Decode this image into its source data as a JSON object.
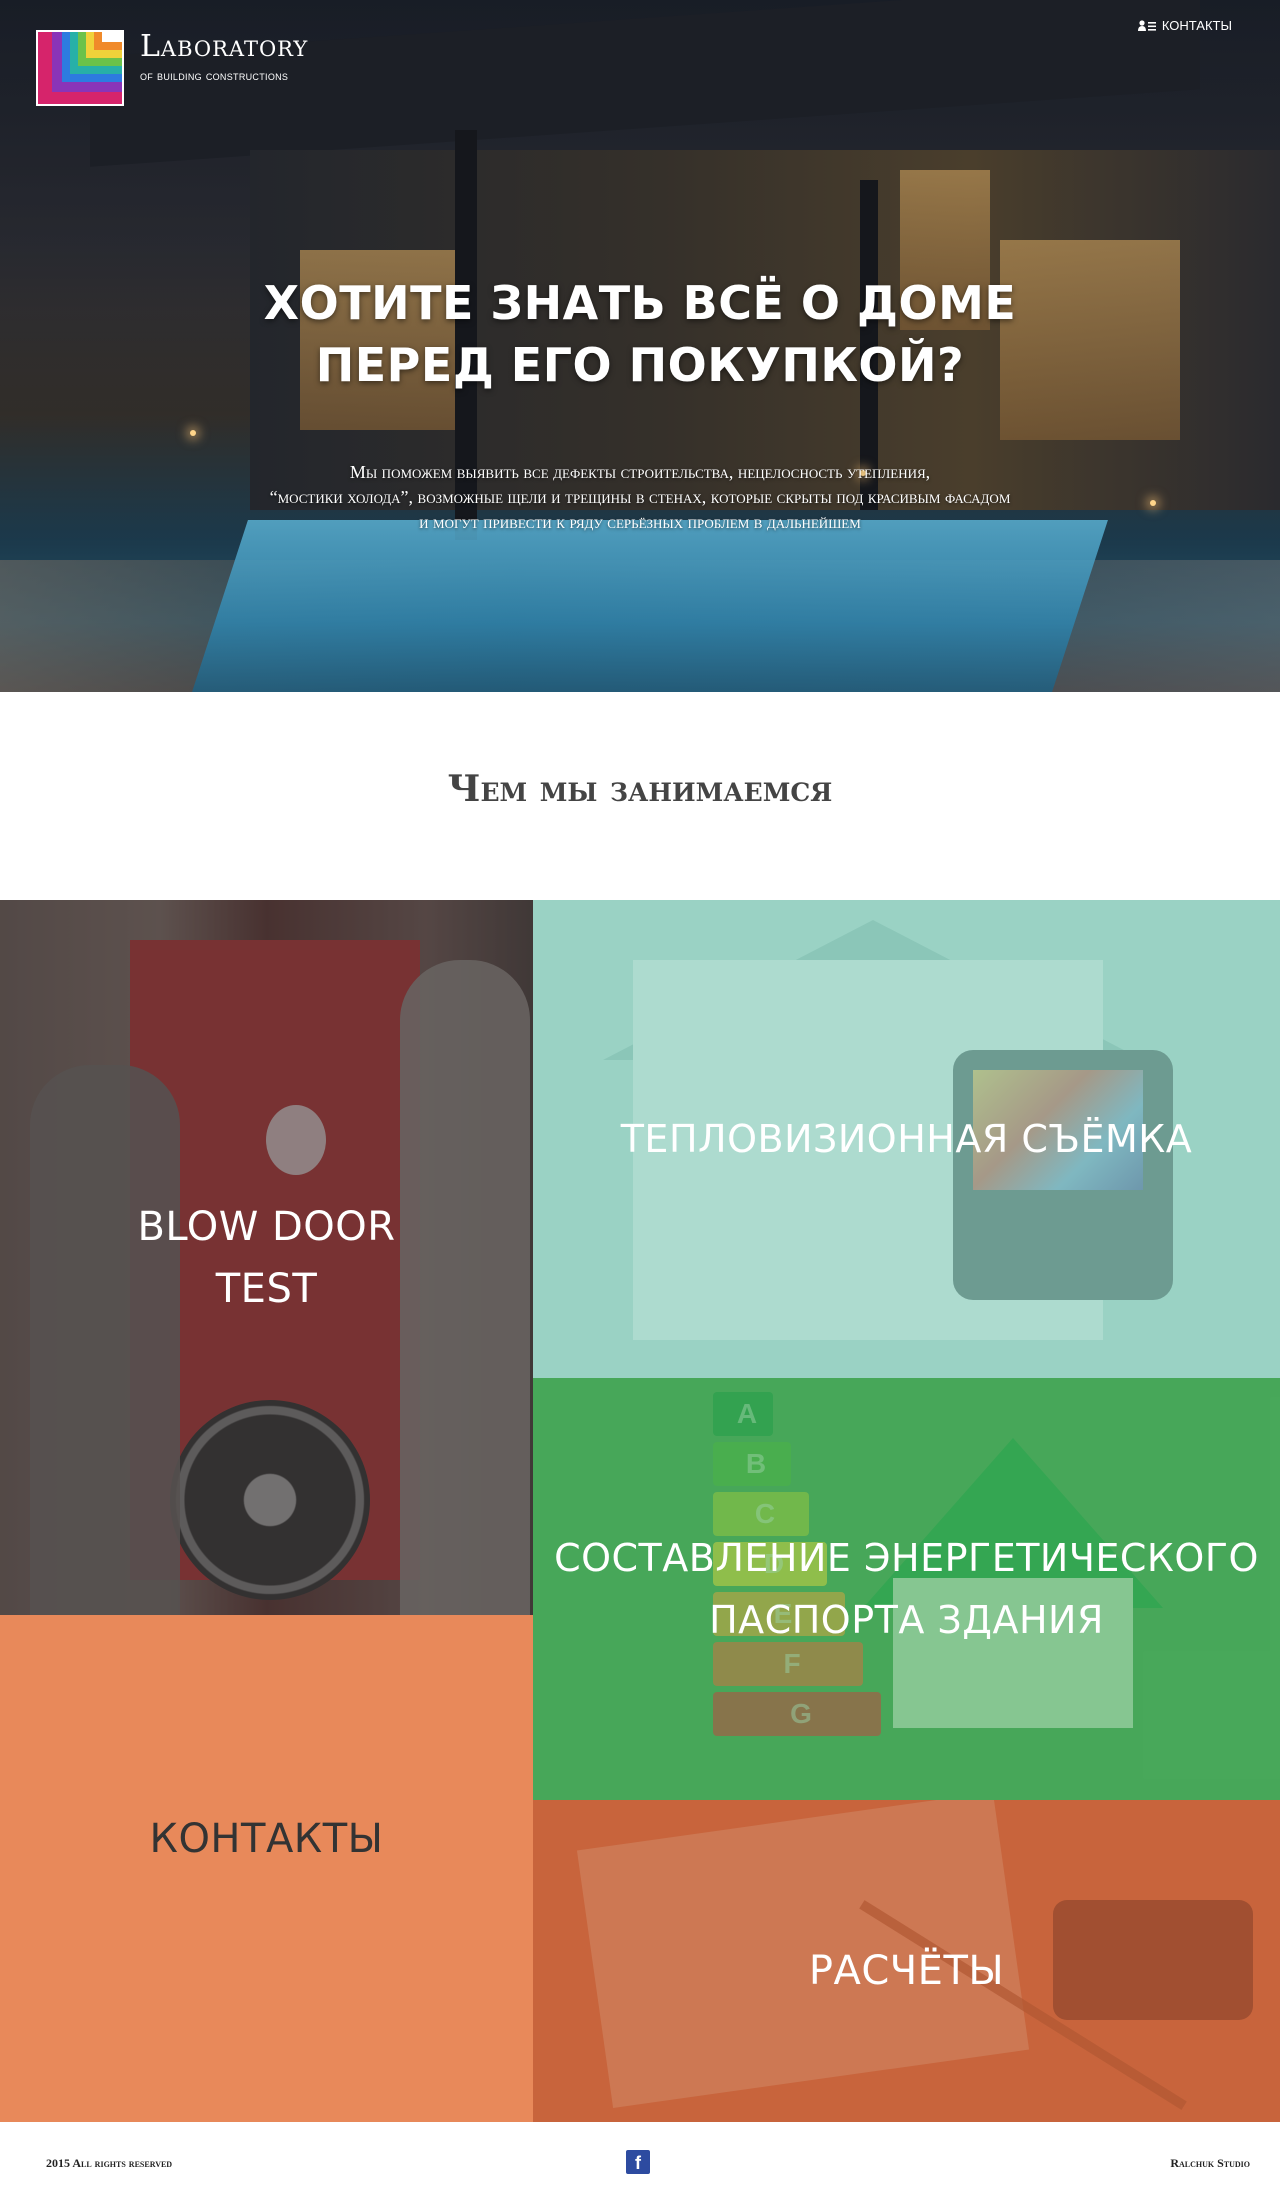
{
  "header": {
    "logo_title": "Laboratory",
    "logo_subtitle": "of building constructions",
    "contacts_label": "КОНТАКТЫ",
    "contacts_icon": "user-list-icon"
  },
  "hero": {
    "title_line1": "Хотите знать всё о доме",
    "title_line2": "перед его покупкой?",
    "subtitle_line1": "Мы поможем выявить все дефекты строительства, нецелосность утепления,",
    "subtitle_line2": "“мостики холода”, возможные щели и трещины в стенах, которые скрыты под красивым фасадом",
    "subtitle_line3": "и могут привести к ряду серьёзных проблем в дальнейшем"
  },
  "services": {
    "section_title": "Чем мы занимаемся",
    "blowdoor_line1": "BLOW DOOR",
    "blowdoor_line2": "TEST",
    "thermal": "ТЕПЛОВИЗИОННАЯ СЪЁМКА",
    "energy_line1": "СОСТАВЛЕНИЕ ЭНЕРГЕТИЧЕСКОГО",
    "energy_line2": "ПАСПОРТА ЗДАНИЯ",
    "energy_classes": [
      "A",
      "B",
      "C",
      "D",
      "E",
      "F",
      "G"
    ],
    "contacts": "КОНТАКТЫ",
    "calc": "РАСЧЁТЫ"
  },
  "colors": {
    "contacts_tile": "#e8895a",
    "thermal_tile": "#9fd3c6",
    "energy_tile": "#4aa55a",
    "calc_tile": "#c8653c",
    "facebook": "#2d4ba0"
  },
  "footer": {
    "copyright": "2015 All rights reserved",
    "facebook_letter": "f",
    "studio": "Ralchuk Studio"
  }
}
